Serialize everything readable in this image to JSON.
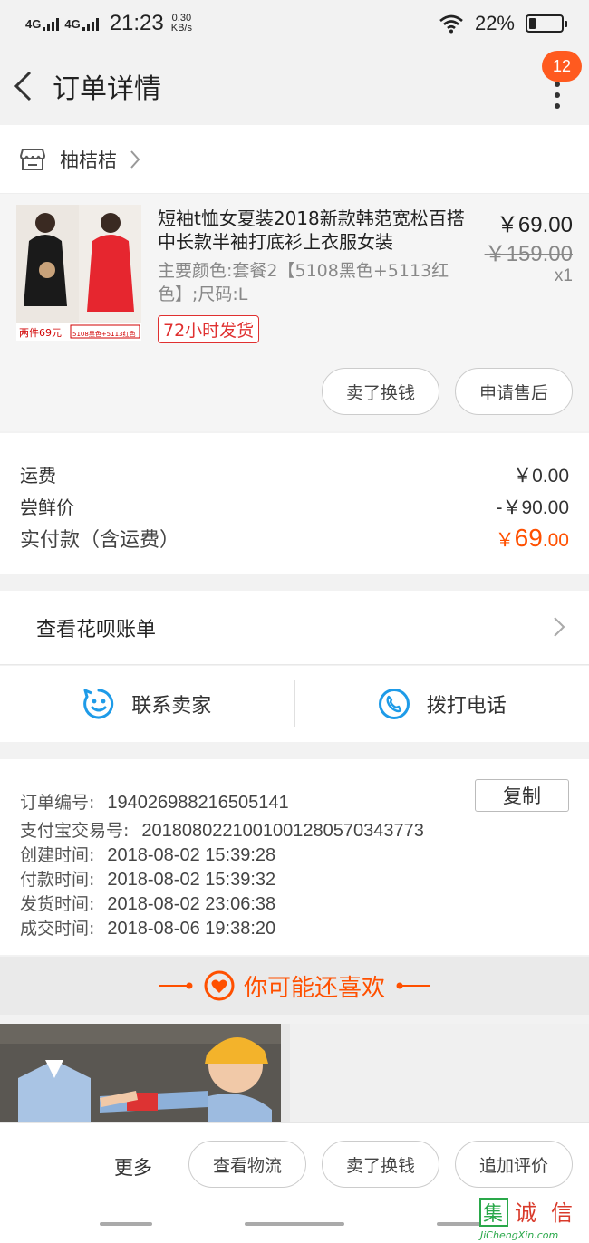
{
  "status_bar": {
    "signal1": "4G",
    "signal2": "4G",
    "time": "21:23",
    "speed_value": "0.30",
    "speed_unit": "KB/s",
    "battery_percent_label": "22%",
    "battery_level": 0.22
  },
  "navbar": {
    "title": "订单详情",
    "badge_count": "12"
  },
  "shop": {
    "name": "柚桔桔"
  },
  "item": {
    "title": "短袖t恤女夏装2018新款韩范宽松百搭中长款半袖打底衫上衣服女装",
    "spec": "主要颜色:套餐2【5108黑色+5113红色】;尺码:L",
    "tag": "72小时发货",
    "price": "￥69.00",
    "original_price": "￥159.00",
    "quantity": "x1",
    "thumb_caption": "两件69元",
    "thumb_sub": "5108黑色+5113红色",
    "buttons": [
      "卖了换钱",
      "申请售后"
    ]
  },
  "fees": {
    "shipping_label": "运费",
    "shipping_value": "￥0.00",
    "discount_label": "尝鲜价",
    "discount_value": "-￥90.00",
    "total_label": "实付款（含运费）",
    "total_currency": "￥",
    "total_int": "69",
    "total_dec": ".00"
  },
  "huabei": {
    "label": "查看花呗账单"
  },
  "contact": {
    "seller_label": "联系卖家",
    "call_label": "拨打电话"
  },
  "order_info": {
    "order_no_label": "订单编号:",
    "order_no": "194026988216505141",
    "copy_label": "复制",
    "alipay_label": "支付宝交易号:",
    "alipay_no": "2018080221001001280570343773",
    "created_label": "创建时间:",
    "created": "2018-08-02 15:39:28",
    "paid_label": "付款时间:",
    "paid": "2018-08-02 15:39:32",
    "shipped_label": "发货时间:",
    "shipped": "2018-08-02 23:06:38",
    "completed_label": "成交时间:",
    "completed": "2018-08-06 19:38:20"
  },
  "recommend": {
    "title": "你可能还喜欢"
  },
  "bottom_bar": {
    "more_label": "更多",
    "buttons": [
      "查看物流",
      "卖了换钱",
      "追加评价"
    ]
  },
  "watermark": {
    "char1": "集",
    "char2": "诚",
    "char3": "信",
    "url": "JiChengXin.com"
  },
  "colors": {
    "accent": "#ff5000",
    "badge": "#ff5a1f",
    "tag_red": "#e03030",
    "contact_blue": "#1e9be8"
  }
}
